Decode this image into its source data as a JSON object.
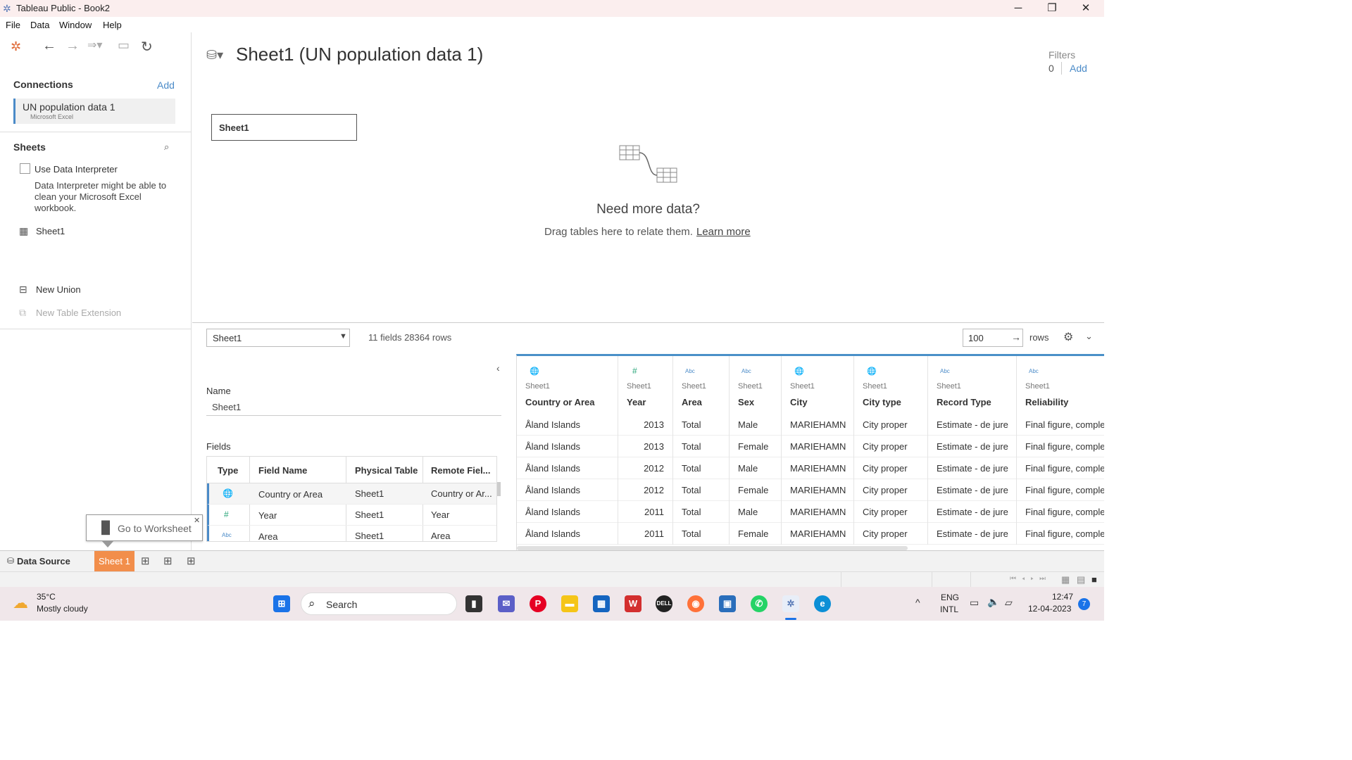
{
  "window": {
    "title": "Tableau Public - Book2",
    "minimize": "─",
    "maximize": "❐",
    "close": "✕"
  },
  "menu": [
    "File",
    "Data",
    "Window",
    "Help"
  ],
  "left": {
    "connections_title": "Connections",
    "connections_add": "Add",
    "connection_name": "UN population data 1",
    "connection_type": "Microsoft Excel",
    "sheets_title": "Sheets",
    "use_interpreter": "Use Data Interpreter",
    "interpreter_note": "Data Interpreter might be able to clean your Microsoft Excel workbook.",
    "sheet_item": "Sheet1",
    "new_union": "New Union",
    "new_table_extension": "New Table Extension"
  },
  "canvas": {
    "datasource_title": "Sheet1 (UN population data 1)",
    "filters_label": "Filters",
    "filters_count": "0",
    "filters_add": "Add",
    "table_box": "Sheet1",
    "need_more": "Need more data?",
    "drag_text": "Drag tables here to relate them.",
    "learn_more": "Learn more"
  },
  "preview_bar": {
    "table_select": "Sheet1",
    "summary": "11 fields 28364 rows",
    "rows_value": "100",
    "rows_label": "rows"
  },
  "metadata": {
    "name_label": "Name",
    "name_value": "Sheet1",
    "fields_label": "Fields",
    "columns": [
      "Type",
      "Field Name",
      "Physical Table",
      "Remote Fiel..."
    ],
    "rows": [
      {
        "type_icon": "globe-icon",
        "type_glyph": "🌐",
        "field": "Country or Area",
        "table": "Sheet1",
        "remote": "Country or Ar..."
      },
      {
        "type_icon": "number-icon",
        "type_glyph": "#",
        "field": "Year",
        "table": "Sheet1",
        "remote": "Year"
      },
      {
        "type_icon": "string-icon",
        "type_glyph": "Abc",
        "field": "Area",
        "table": "Sheet1",
        "remote": "Area"
      }
    ]
  },
  "grid": {
    "columns": [
      {
        "type": "globe",
        "type_glyph": "🌐",
        "source": "Sheet1",
        "name": "Country or Area"
      },
      {
        "type": "number",
        "type_glyph": "#",
        "source": "Sheet1",
        "name": "Year"
      },
      {
        "type": "string",
        "type_glyph": "Abc",
        "source": "Sheet1",
        "name": "Area"
      },
      {
        "type": "string",
        "type_glyph": "Abc",
        "source": "Sheet1",
        "name": "Sex"
      },
      {
        "type": "globe",
        "type_glyph": "🌐",
        "source": "Sheet1",
        "name": "City"
      },
      {
        "type": "globe",
        "type_glyph": "🌐",
        "source": "Sheet1",
        "name": "City type"
      },
      {
        "type": "string",
        "type_glyph": "Abc",
        "source": "Sheet1",
        "name": "Record Type"
      },
      {
        "type": "string",
        "type_glyph": "Abc",
        "source": "Sheet1",
        "name": "Reliability"
      }
    ],
    "rows": [
      [
        "Åland Islands",
        "2013",
        "Total",
        "Male",
        "MARIEHAMN",
        "City proper",
        "Estimate - de jure",
        "Final figure, complete"
      ],
      [
        "Åland Islands",
        "2013",
        "Total",
        "Female",
        "MARIEHAMN",
        "City proper",
        "Estimate - de jure",
        "Final figure, complete"
      ],
      [
        "Åland Islands",
        "2012",
        "Total",
        "Male",
        "MARIEHAMN",
        "City proper",
        "Estimate - de jure",
        "Final figure, complete"
      ],
      [
        "Åland Islands",
        "2012",
        "Total",
        "Female",
        "MARIEHAMN",
        "City proper",
        "Estimate - de jure",
        "Final figure, complete"
      ],
      [
        "Åland Islands",
        "2011",
        "Total",
        "Male",
        "MARIEHAMN",
        "City proper",
        "Estimate - de jure",
        "Final figure, complete"
      ],
      [
        "Åland Islands",
        "2011",
        "Total",
        "Female",
        "MARIEHAMN",
        "City proper",
        "Estimate - de jure",
        "Final figure, complete"
      ]
    ]
  },
  "tooltip": {
    "goto_worksheet": "Go to Worksheet"
  },
  "tabs": {
    "data_source": "Data Source",
    "sheet1": "Sheet 1"
  },
  "taskbar": {
    "weather_temp": "35°C",
    "weather_desc": "Mostly cloudy",
    "search": "Search",
    "lang1": "ENG",
    "lang2": "INTL",
    "time": "12:47",
    "date": "12-04-2023",
    "notif_count": "7"
  },
  "colors": {
    "accent_blue": "#4b8bc8",
    "sheet_tab_orange": "#f28e4b",
    "grid_top_border": "#4a90c8"
  }
}
